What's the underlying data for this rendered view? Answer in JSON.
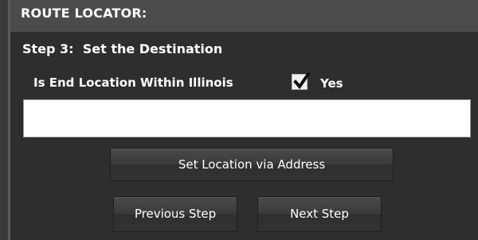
{
  "header": {
    "title": "ROUTE LOCATOR:"
  },
  "step": {
    "title": "Step 3:  Set the Destination"
  },
  "end_location": {
    "question": "Is End Location Within Illinois",
    "checked": true,
    "yes_label": "Yes"
  },
  "location_input": {
    "value": "",
    "placeholder": ""
  },
  "buttons": {
    "set_location": "Set Location via Address",
    "previous": "Previous Step",
    "next": "Next Step"
  },
  "colors": {
    "panel_bg": "#2e2e2e",
    "header_bg": "#4b4b4b",
    "text": "#ffffff"
  }
}
